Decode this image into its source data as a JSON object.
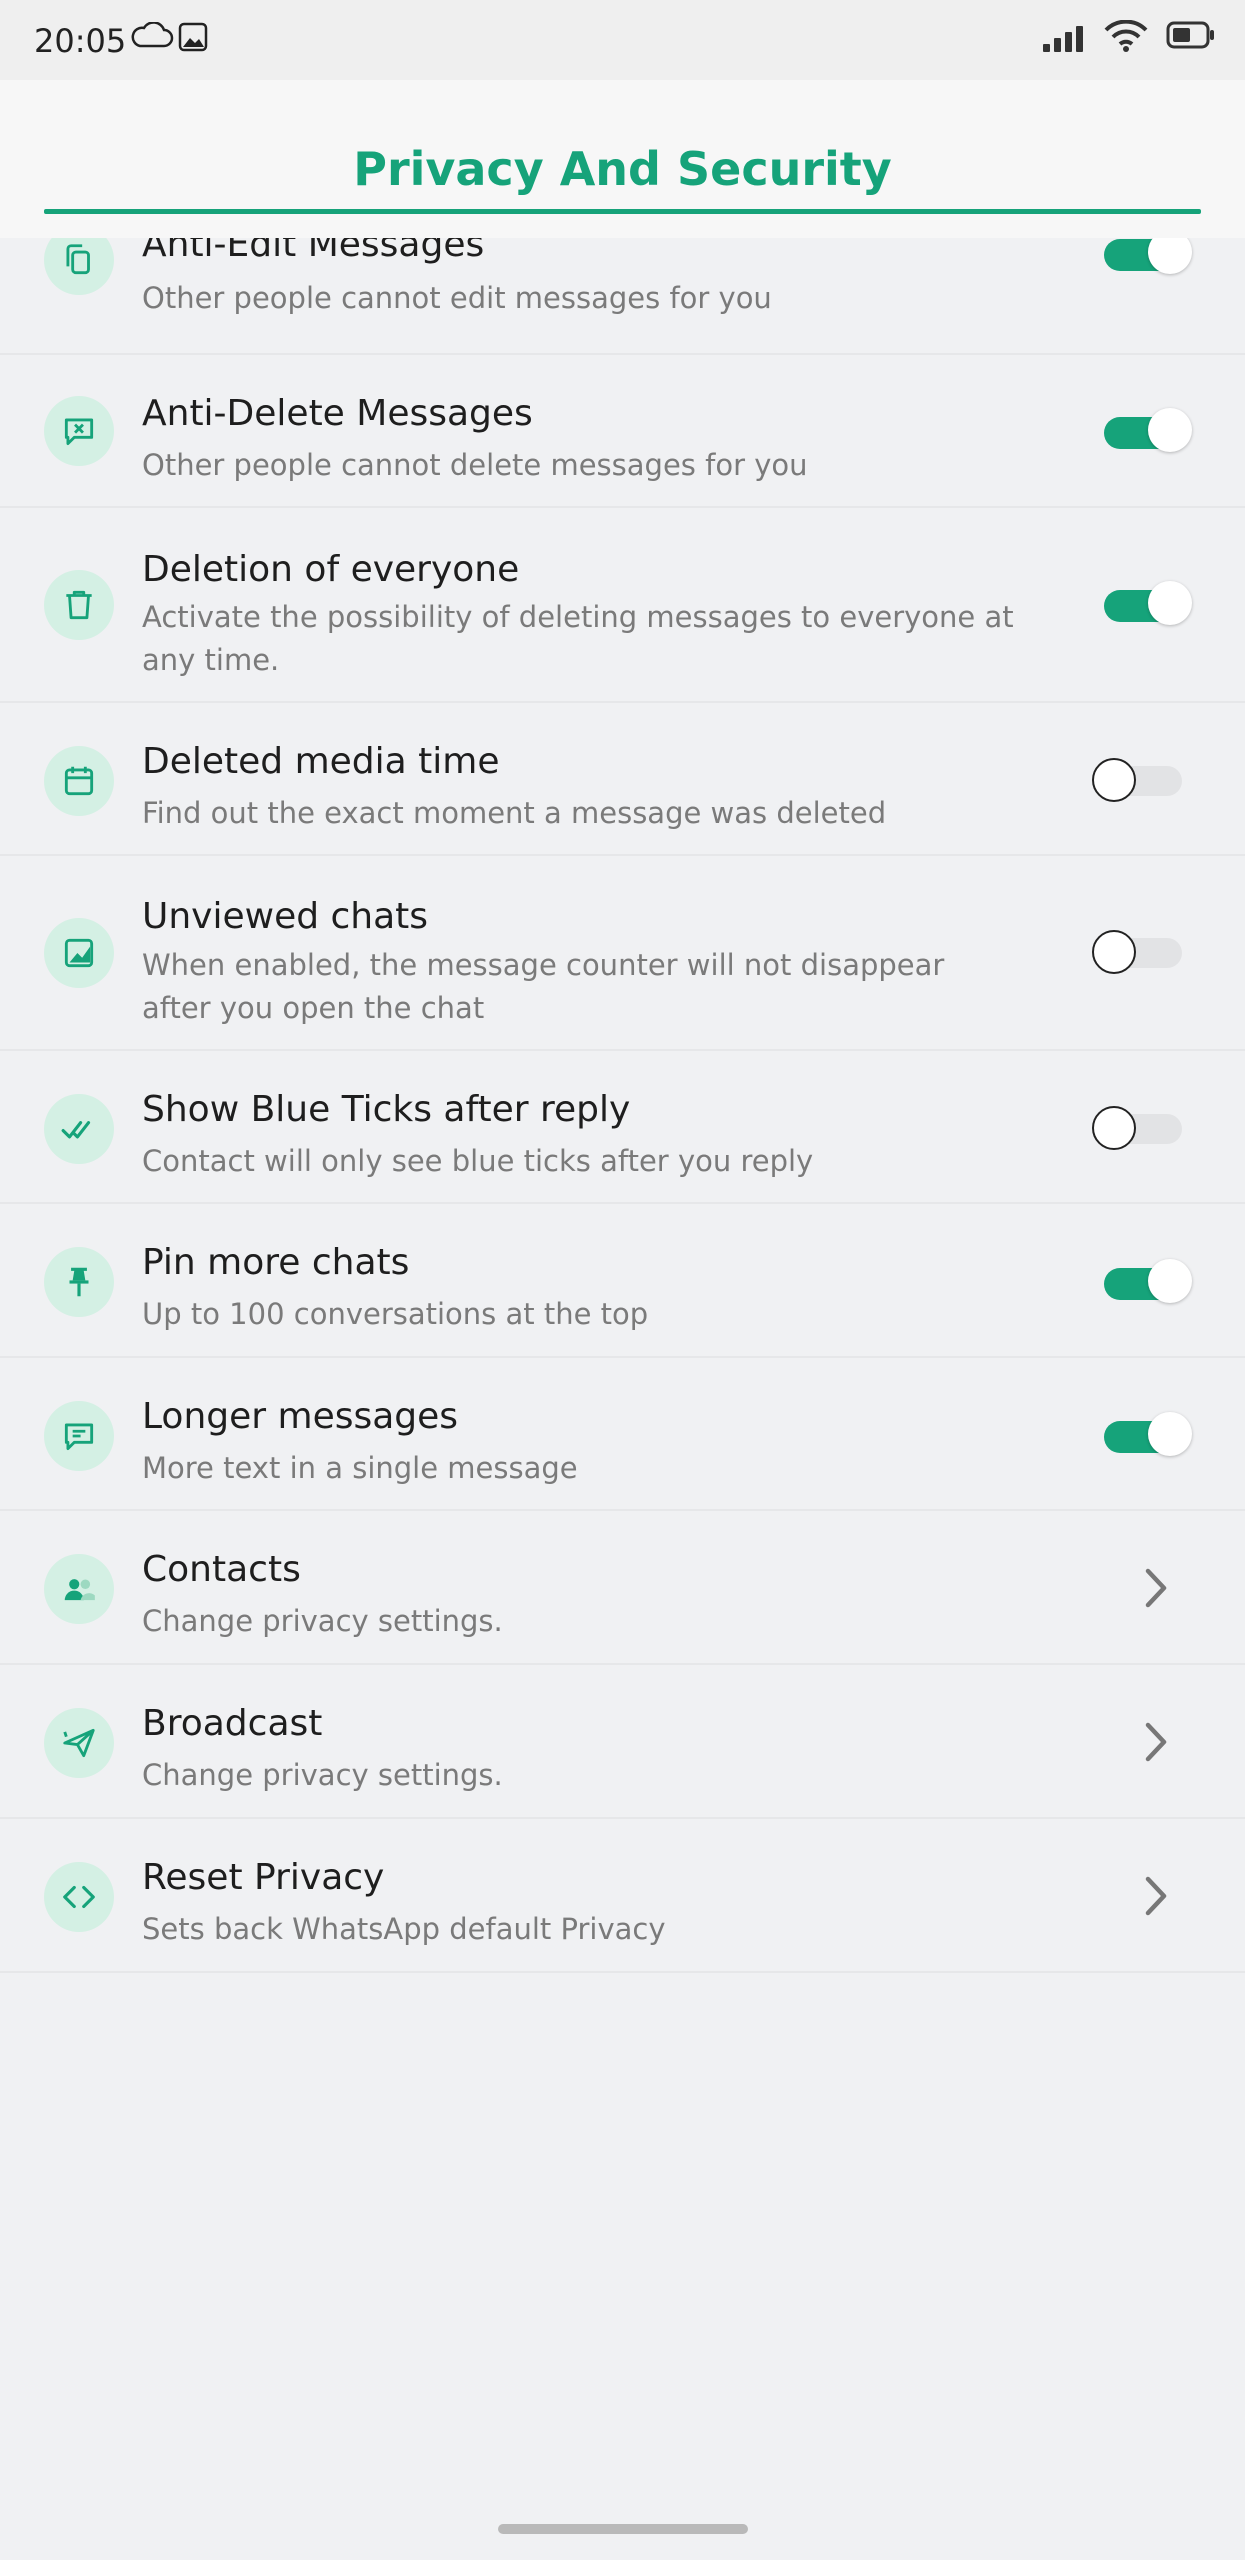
{
  "status_bar": {
    "time": "20:05",
    "icons": [
      "cloud-icon",
      "image-icon",
      "signal-icon",
      "wifi-icon",
      "battery-icon"
    ]
  },
  "header": {
    "title": "Privacy And Security"
  },
  "colors": {
    "accent": "#16a37a",
    "icon_bg": "#d4f0e4",
    "background": "#f0f1f3"
  },
  "settings": [
    {
      "title": "Anti-Edit Messages",
      "subtitle": "Other people cannot edit messages for you",
      "control": "toggle",
      "enabled": true,
      "icon": "copy-icon"
    },
    {
      "title": "Anti-Delete Messages",
      "subtitle": "Other people cannot delete messages for you",
      "control": "toggle",
      "enabled": true,
      "icon": "message-x-icon"
    },
    {
      "title": "Deletion of everyone",
      "subtitle": "Activate the possibility of deleting messages to everyone at any time.",
      "control": "toggle",
      "enabled": true,
      "icon": "trash-icon"
    },
    {
      "title": "Deleted media time",
      "subtitle": "Find out the exact moment a message was deleted",
      "control": "toggle",
      "enabled": false,
      "icon": "calendar-icon"
    },
    {
      "title": "Unviewed chats",
      "subtitle": "When enabled, the message counter will not disappear after you open the chat",
      "control": "toggle",
      "enabled": false,
      "icon": "chart-icon"
    },
    {
      "title": "Show Blue Ticks after reply",
      "subtitle": "Contact will only see blue ticks after you reply",
      "control": "toggle",
      "enabled": false,
      "icon": "double-check-icon"
    },
    {
      "title": "Pin more chats",
      "subtitle": "Up to 100 conversations at the top",
      "control": "toggle",
      "enabled": true,
      "icon": "pin-icon"
    },
    {
      "title": "Longer messages",
      "subtitle": "More text in a single message",
      "control": "toggle",
      "enabled": true,
      "icon": "message-lines-icon"
    },
    {
      "title": "Contacts",
      "subtitle": "Change privacy settings.",
      "control": "chevron",
      "icon": "contacts-icon"
    },
    {
      "title": "Broadcast",
      "subtitle": "Change privacy settings.",
      "control": "chevron",
      "icon": "send-icon"
    },
    {
      "title": "Reset Privacy",
      "subtitle": "Sets back WhatsApp default Privacy",
      "control": "chevron",
      "icon": "code-icon"
    }
  ]
}
